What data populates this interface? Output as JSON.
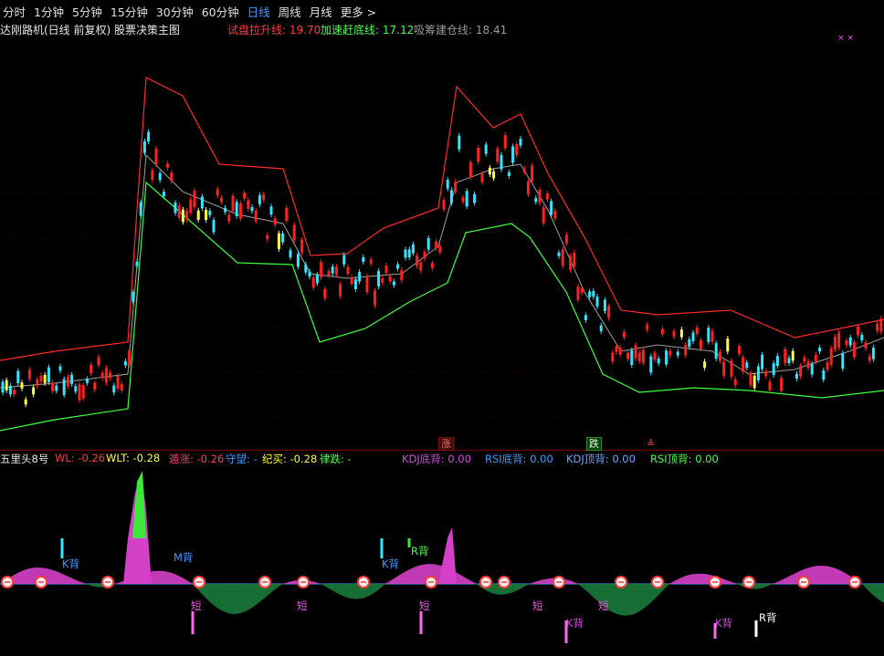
{
  "toolbar": {
    "periods": [
      "分时",
      "1分钟",
      "5分钟",
      "15分钟",
      "30分钟",
      "60分钟",
      "日线",
      "周线",
      "月线",
      "更多 >"
    ],
    "active_period": "日线"
  },
  "main_panel": {
    "title": "达刚路机(日线 前复权) 股票决策主图",
    "indicators": [
      {
        "label": "试盘拉升线: 19.70",
        "color": "#ff3b3b"
      },
      {
        "label": "加速赶底线: 17.12",
        "color": "#4cff4c"
      },
      {
        "label": "吸筹建仓线: 18.41",
        "color": "#9a9a9a"
      }
    ],
    "markers": {
      "rise": "涨",
      "fall": "跌",
      "other": "≙"
    }
  },
  "sub_panel": {
    "title": "五里头8号",
    "indicators": [
      {
        "label": "WL: -0.26",
        "color": "#ff3b3b"
      },
      {
        "label": "WLT: -0.28",
        "color": "#ffff33"
      },
      {
        "label": "遁涨: -0.26",
        "color": "#ff3b6e"
      },
      {
        "label": "守望: -",
        "color": "#3f9cff"
      },
      {
        "label": "纪买: -0.28",
        "color": "#ffff33"
      },
      {
        "label": "律跌: -",
        "color": "#4cff4c"
      },
      {
        "label": "KDJ底背: 0.00",
        "color": "#d54ce0"
      },
      {
        "label": "RSI底背: 0.00",
        "color": "#3f9cff"
      },
      {
        "label": "KDJ顶背: 0.00",
        "color": "#6aa8ff"
      },
      {
        "label": "RSI顶背: 0.00",
        "color": "#4cff4c"
      }
    ],
    "annotations": {
      "k_div": "K背",
      "m_div": "M背",
      "r_div": "R背",
      "short": "短"
    }
  },
  "colors": {
    "background": "#000000",
    "up": "#ff2020",
    "down": "#33e5ff",
    "upper_band": "#ff2a2a",
    "middle_band": "#a0a0a0",
    "lower_band": "#3cff3c",
    "area_pink": "#d440c8",
    "area_green": "#1a7a3a"
  }
}
